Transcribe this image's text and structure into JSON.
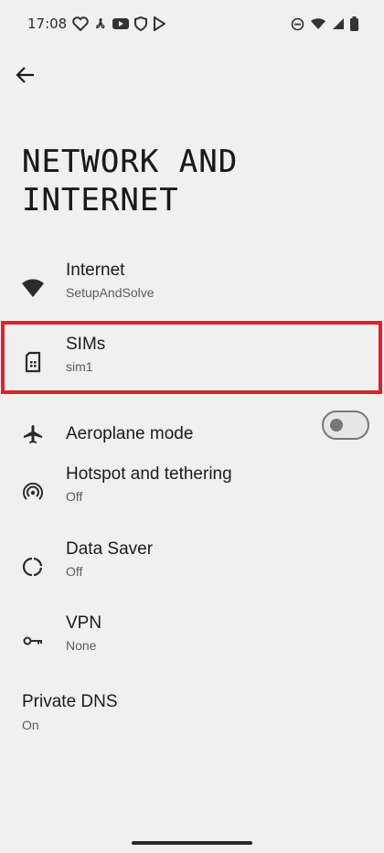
{
  "status_bar": {
    "time": "17:08",
    "left_icons": [
      "heart-health-icon",
      "fan-icon",
      "youtube-icon",
      "shield-icon",
      "play-store-icon"
    ],
    "right_icons": [
      "dnd-icon",
      "wifi-icon",
      "signal-icon",
      "battery-icon"
    ]
  },
  "header": {
    "title_line1": "NETWORK AND",
    "title_line2": "INTERNET"
  },
  "items": [
    {
      "icon": "wifi-icon",
      "title": "Internet",
      "subtitle": "SetupAndSolve"
    },
    {
      "icon": "sim-card-icon",
      "title": "SIMs",
      "subtitle": "sim1"
    },
    {
      "icon": "airplane-icon",
      "title": "Aeroplane mode",
      "toggle_on": false
    },
    {
      "icon": "hotspot-icon",
      "title": "Hotspot and tethering",
      "subtitle": "Off"
    },
    {
      "icon": "data-saver-icon",
      "title": "Data Saver",
      "subtitle": "Off"
    },
    {
      "icon": "vpn-key-icon",
      "title": "VPN",
      "subtitle": "None"
    }
  ],
  "private_dns": {
    "title": "Private DNS",
    "subtitle": "On"
  },
  "colors": {
    "highlight": "#e0202a",
    "background": "#f0f0f0"
  }
}
